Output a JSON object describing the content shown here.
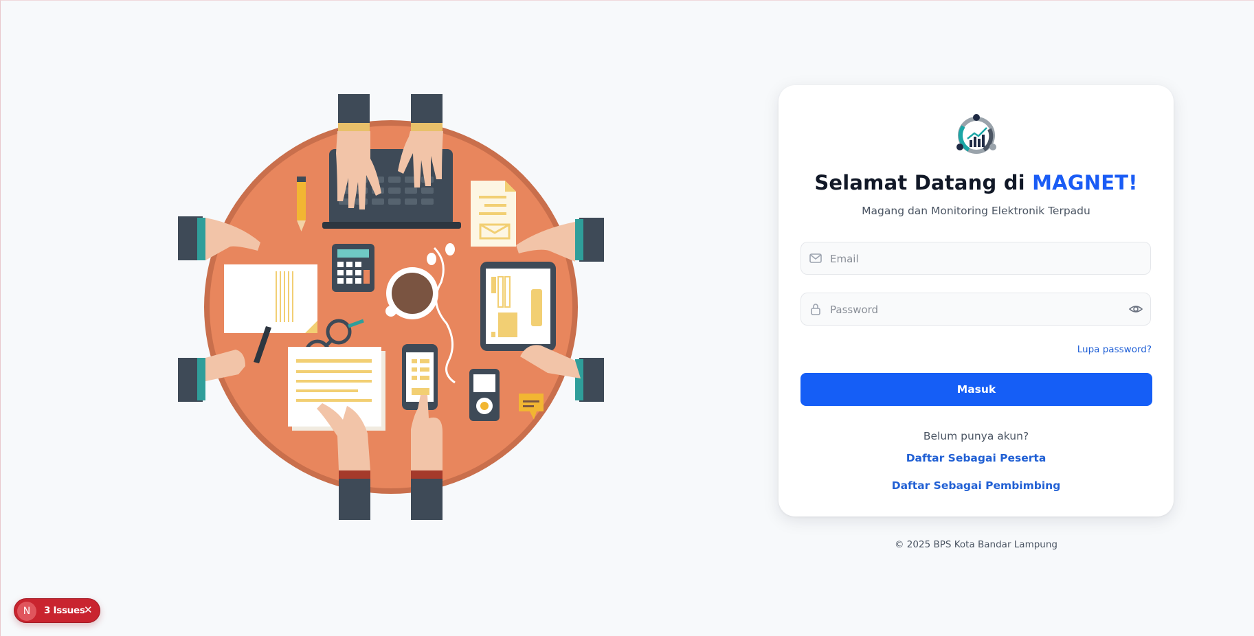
{
  "login": {
    "title_prefix": "Selamat Datang di ",
    "title_brand": "MAGNET!",
    "subtitle": "Magang dan Monitoring Elektronik Terpadu",
    "email_placeholder": "Email",
    "password_placeholder": "Password",
    "forgot_label": "Lupa password?",
    "submit_label": "Masuk",
    "no_account_text": "Belum punya akun?",
    "register_participant_label": "Daftar Sebagai Peserta",
    "register_mentor_label": "Daftar Sebagai Pembimbing"
  },
  "footer": {
    "copyright": "© 2025 BPS Kota Bandar Lampung"
  },
  "dev_overlay": {
    "badge_letter": "N",
    "issues_label": "3 Issues",
    "close_glyph": "✕"
  },
  "icons": {
    "email_field": "mail-icon",
    "password_field": "lock-icon",
    "password_toggle": "eye-icon",
    "logo": "magnet-logo"
  },
  "colors": {
    "brand": "#1a5cf5",
    "primary_button": "#155ef6",
    "link": "#2160d4",
    "issues_badge": "#c9242f",
    "table": "#e8855d",
    "background": "#f7f9fb"
  }
}
